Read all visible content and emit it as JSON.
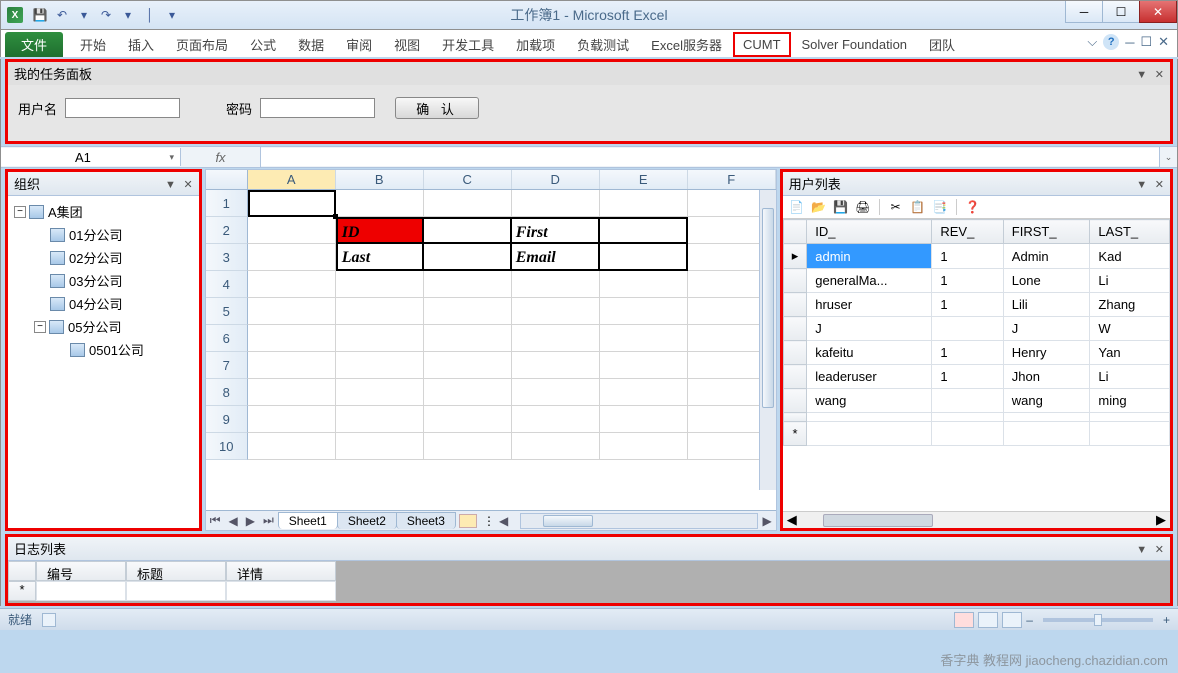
{
  "title": "工作簿1 - Microsoft Excel",
  "qat": {
    "save": "💾",
    "undo": "↶",
    "redo": "↷",
    "more": "▾",
    "sep": "│",
    "more2": "▾"
  },
  "win": {
    "min": "─",
    "max": "☐",
    "close": "✕"
  },
  "ribbon": {
    "file": "文件",
    "tabs": [
      "开始",
      "插入",
      "页面布局",
      "公式",
      "数据",
      "审阅",
      "视图",
      "开发工具",
      "加载项",
      "负载测试",
      "Excel服务器",
      "CUMT",
      "Solver Foundation",
      "团队"
    ],
    "highlight_index": 11
  },
  "ribbon_right": {
    "collapse": "⌵",
    "help": "?",
    "restore": "☐",
    "wmin": "─",
    "wmax": "☐",
    "wclose": "✕"
  },
  "task_panel": {
    "title": "我的任务面板",
    "user_label": "用户名",
    "pwd_label": "密码",
    "confirm": "确 认"
  },
  "name_box": "A1",
  "fx": "fx",
  "org": {
    "title": "组织",
    "root": "A集团",
    "children": [
      "01分公司",
      "02分公司",
      "03分公司",
      "04分公司",
      "05分公司"
    ],
    "grandchild": "0501公司"
  },
  "sheet": {
    "cols": [
      "A",
      "B",
      "C",
      "D",
      "E",
      "F"
    ],
    "rows": [
      1,
      2,
      3,
      4,
      5,
      6,
      7,
      8,
      9,
      10
    ],
    "tbl": {
      "r2": {
        "B": "ID",
        "D": "First"
      },
      "r3": {
        "B": "Last",
        "D": "Email"
      }
    },
    "tabs": [
      "Sheet1",
      "Sheet2",
      "Sheet3"
    ]
  },
  "users": {
    "title": "用户列表",
    "toolbar_icons": [
      "📄",
      "📂",
      "💾",
      "🖨",
      "",
      "✂",
      "📋",
      "📑",
      "",
      "❓"
    ],
    "cols": [
      "ID_",
      "REV_",
      "FIRST_",
      "LAST_"
    ],
    "rows": [
      {
        "id": "admin",
        "rev": "1",
        "first": "Admin",
        "last": "Kad",
        "sel": true
      },
      {
        "id": "generalMa...",
        "rev": "1",
        "first": "Lone",
        "last": "Li"
      },
      {
        "id": "hruser",
        "rev": "1",
        "first": "Lili",
        "last": "Zhang"
      },
      {
        "id": "J",
        "rev": "",
        "first": "J",
        "last": "W"
      },
      {
        "id": "kafeitu",
        "rev": "1",
        "first": "Henry",
        "last": "Yan"
      },
      {
        "id": "leaderuser",
        "rev": "1",
        "first": "Jhon",
        "last": "Li"
      },
      {
        "id": "wang",
        "rev": "",
        "first": "wang",
        "last": "ming"
      }
    ],
    "row_marker": "▸",
    "new_marker": "*"
  },
  "log": {
    "title": "日志列表",
    "cols": [
      "编号",
      "标题",
      "详情"
    ],
    "new_marker": "*"
  },
  "status": {
    "ready": "就绪",
    "zoom_minus": "–",
    "zoom_plus": "+"
  },
  "watermark": "香字典 教程网\njiaocheng.chazidian.com",
  "close_x": "✕",
  "dropdown": "▼"
}
